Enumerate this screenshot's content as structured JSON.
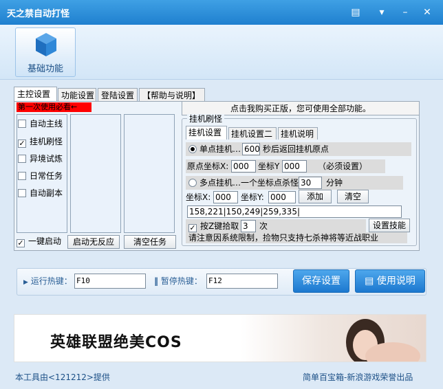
{
  "window": {
    "title": "天之禁自动打怪"
  },
  "nav": {
    "tile_label": "基础功能"
  },
  "main_tabs": [
    "主控设置",
    "功能设置",
    "登陆设置",
    "【帮助与说明】"
  ],
  "left": {
    "warning": "第一次使用必看←",
    "checks": [
      {
        "label": "自动主线",
        "checked": false
      },
      {
        "label": "挂机刷怪",
        "checked": true
      },
      {
        "label": "异境试炼",
        "checked": false
      },
      {
        "label": "日常任务",
        "checked": false
      },
      {
        "label": "自动副本",
        "checked": false
      }
    ],
    "one_key_start": {
      "label": "一键启动",
      "checked": true
    },
    "btn_no_response": "启动无反应",
    "btn_clear_tasks": "清空任务"
  },
  "buy": {
    "text": "点击我购买正版，您可使用全部功能。"
  },
  "hang": {
    "group_title": "挂机刷怪",
    "sub_tabs": [
      "挂机设置",
      "挂机设置二",
      "挂机说明"
    ],
    "single": {
      "label": "单点挂机…",
      "seconds": "600",
      "suffix": "秒后返回挂机原点"
    },
    "origin": {
      "x_label": "原点坐标X:",
      "x": "000",
      "y_label": "坐标Y",
      "y": "000",
      "note": "（必须设置）"
    },
    "multi": {
      "label": "多点挂机…一个坐标点杀怪",
      "minutes": "30",
      "suffix": "分钟"
    },
    "coord": {
      "x_label": "坐标X:",
      "x": "000",
      "y_label": "坐标Y:",
      "y": "000",
      "add": "添加",
      "clear": "清空"
    },
    "points": "158,221|150,249|259,335|",
    "pickup": {
      "label": "按Z键拾取",
      "count": "3",
      "unit": "次",
      "checked": true,
      "skill_btn": "设置技能"
    },
    "notice": "请注意因系统限制，捡物只支持七杀神将等近战职业"
  },
  "hotkeys": {
    "run_label": "运行热键：",
    "run_value": "F10",
    "pause_label": "暂停热键：",
    "pause_value": "F12",
    "save_btn": "保存设置",
    "help_btn": "使用说明"
  },
  "banner": {
    "text": "英雄联盟绝美COS"
  },
  "footer": {
    "left": "本工具由<121212>提供",
    "right": "简单百宝箱-新浪游戏荣誉出品"
  }
}
